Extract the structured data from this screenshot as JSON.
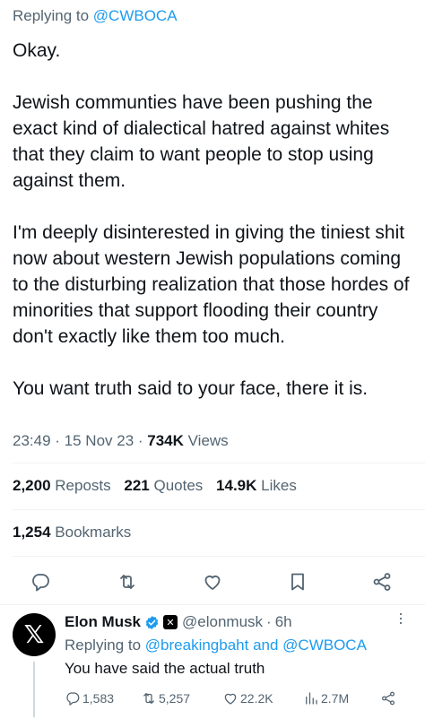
{
  "tweet": {
    "replying_prefix": "Replying to ",
    "replying_handle": "@CWBOCA",
    "text": "Okay.\n\nJewish communties have been pushing the exact kind of dialectical hatred against whites that they claim to want people to stop using against them.\n\nI'm deeply disinterested in giving the tiniest shit now about western Jewish populations coming to the disturbing realization that those hordes of minorities that support flooding their country don't exactly like them too much.\n\nYou want truth said to your face, there it is.",
    "time": "23:49",
    "date": "15 Nov 23",
    "views_count": "734K",
    "views_label": "Views"
  },
  "stats": {
    "reposts_count": "2,200",
    "reposts_label": "Reposts",
    "quotes_count": "221",
    "quotes_label": "Quotes",
    "likes_count": "14.9K",
    "likes_label": "Likes",
    "bookmarks_count": "1,254",
    "bookmarks_label": "Bookmarks"
  },
  "actions": [
    "reply-icon",
    "repost-icon",
    "like-icon",
    "bookmark-icon",
    "share-icon"
  ],
  "reply": {
    "avatar_glyph": "𝕏",
    "name": "Elon Musk",
    "handle": "@elonmusk",
    "separator": "·",
    "time": "6h",
    "replying_prefix": "Replying to ",
    "replying_handle_1": "@breakingbaht",
    "replying_and": " and ",
    "replying_handle_2": "@CWBOCA",
    "text": "You have said the actual truth",
    "replies": "1,583",
    "reposts": "5,257",
    "likes": "22.2K",
    "views": "2.7M"
  },
  "colors": {
    "accent": "#1d9bf0",
    "secondary_text": "#536471",
    "primary_text": "#0f1419",
    "verified_badge": "#1d9bf0"
  }
}
